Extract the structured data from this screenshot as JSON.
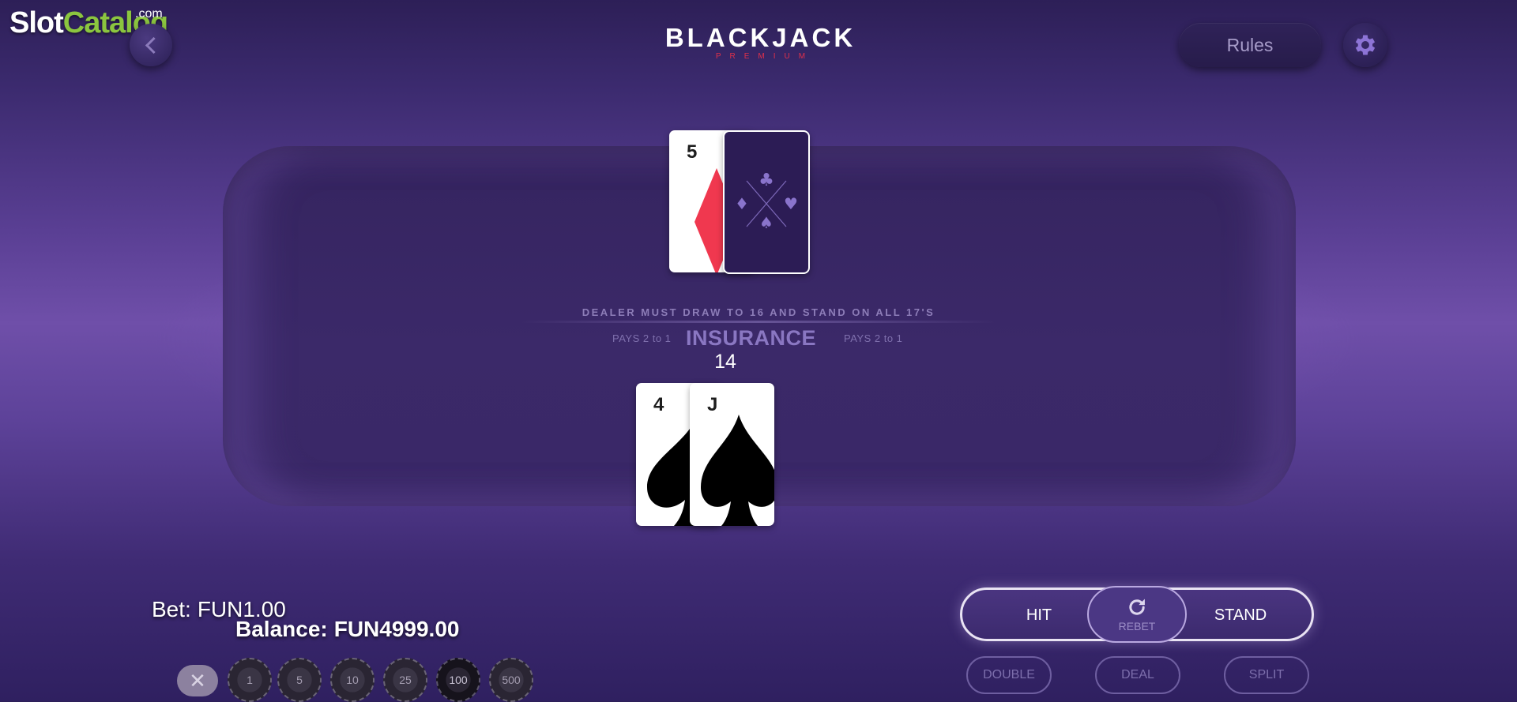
{
  "watermark": {
    "part1": "Slot",
    "part2": "Catalog",
    "suffix": ".com"
  },
  "header": {
    "logo_title": "BLACKJACK",
    "logo_subtitle": "PREMIUM",
    "rules_label": "Rules",
    "back_icon": "chevron-left-icon",
    "settings_icon": "gear-icon"
  },
  "table": {
    "rule_text": "DEALER MUST DRAW TO 16 AND STAND ON ALL 17'S",
    "pays_left": "PAYS 2  to 1",
    "insurance_label": "INSURANCE",
    "pays_right": "PAYS 2  to 1",
    "player_total": "14"
  },
  "dealer_hand": [
    {
      "rank": "5",
      "suit": "diamonds",
      "face_up": true
    },
    {
      "face_up": false
    }
  ],
  "player_hand": [
    {
      "rank": "4",
      "suit": "spades",
      "face_up": true
    },
    {
      "rank": "J",
      "suit": "spades",
      "face_up": true
    }
  ],
  "status": {
    "bet_label": "Bet:",
    "bet_value": "FUN1.00",
    "balance_label": "Balance:",
    "balance_value": "FUN4999.00"
  },
  "chips": {
    "clear_icon": "close-icon",
    "values": [
      "1",
      "5",
      "10",
      "25",
      "100",
      "500"
    ],
    "selected": "100"
  },
  "actions": {
    "hit": "HIT",
    "rebet": "REBET",
    "stand": "STAND",
    "double": "DOUBLE",
    "deal": "DEAL",
    "split": "SPLIT"
  },
  "colors": {
    "accent_red": "#e0304a",
    "watermark_green": "#8bc53f",
    "table": "#3a2867",
    "insurance_text": "#8a77c2"
  }
}
